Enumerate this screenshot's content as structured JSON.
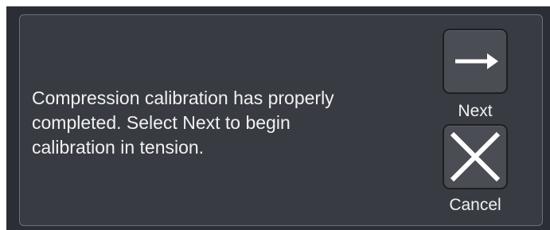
{
  "dialog": {
    "message": "Compression calibration has properly\ncompleted. Select Next to begin\ncalibration in tension.",
    "next_label": "Next",
    "cancel_label": "Cancel",
    "next_icon": "arrow-right-icon",
    "cancel_icon": "close-icon"
  },
  "colors": {
    "background": "#2b2e34",
    "dialog_bg": "#383b42",
    "button_bg": "#4a4d54",
    "text": "#f1f1f1"
  }
}
